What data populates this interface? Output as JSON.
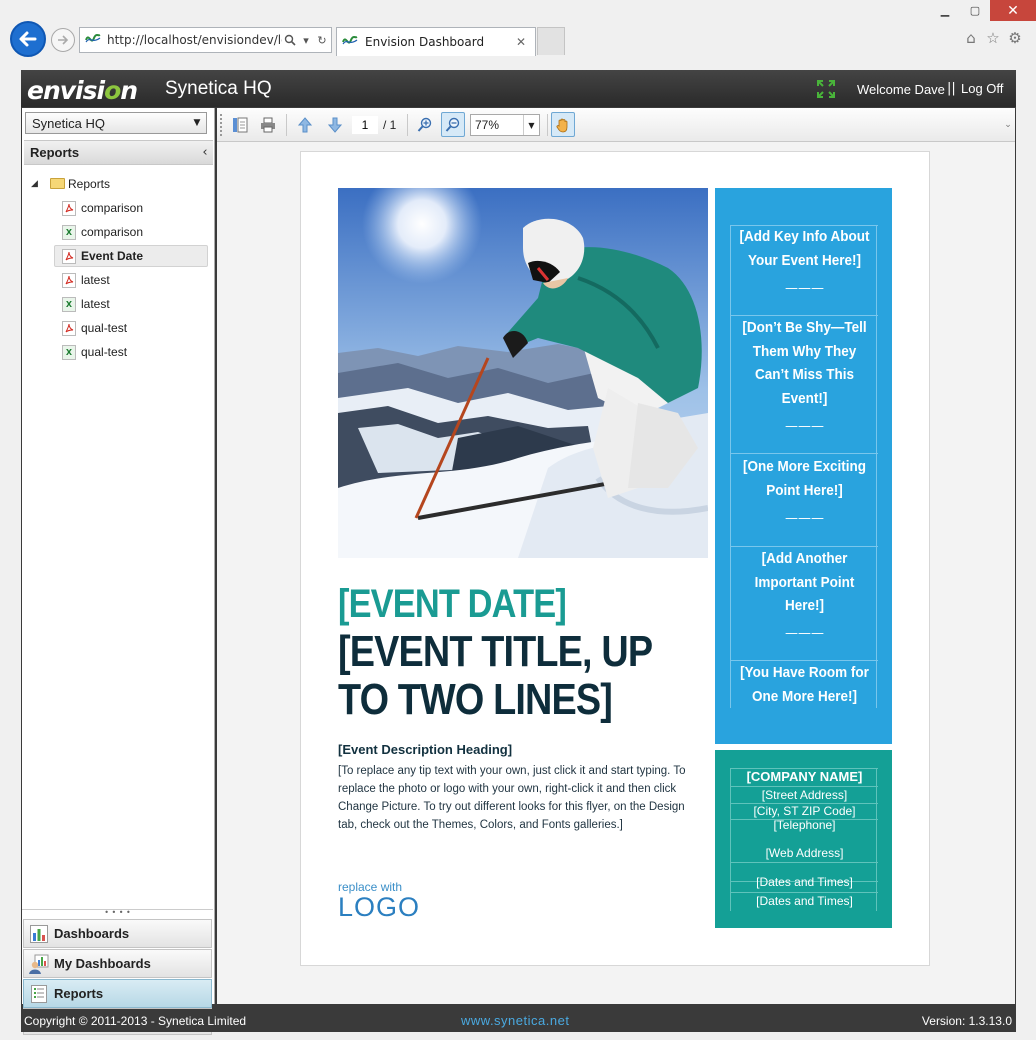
{
  "browser": {
    "url": "http://localhost/envisiondev/log",
    "tab_title": "Envision Dashboard",
    "tab_close": "✕"
  },
  "app": {
    "logo_pre": "envisi",
    "logo_o": "o",
    "logo_post": "n",
    "title": "Synetica HQ",
    "welcome": "Welcome Dave",
    "separator": "||",
    "logoff": "Log Off"
  },
  "sidebar": {
    "org_selected": "Synetica HQ",
    "section_title": "Reports",
    "collapse_glyph": "‹",
    "tree_root": "Reports",
    "items": [
      {
        "label": "comparison",
        "type": "pdf"
      },
      {
        "label": "comparison",
        "type": "xls"
      },
      {
        "label": "Event Date",
        "type": "pdf"
      },
      {
        "label": "latest",
        "type": "pdf"
      },
      {
        "label": "latest",
        "type": "xls"
      },
      {
        "label": "qual-test",
        "type": "pdf"
      },
      {
        "label": "qual-test",
        "type": "xls"
      }
    ],
    "nav": [
      {
        "label": "Dashboards"
      },
      {
        "label": "My Dashboards"
      },
      {
        "label": "Reports"
      }
    ]
  },
  "viewer": {
    "current_page": "1",
    "total_pages": "/ 1",
    "zoom": "77%"
  },
  "document": {
    "event_date": "[EVENT DATE]",
    "event_title": "[EVENT TITLE, UP TO TWO LINES]",
    "desc_heading": "[Event Description Heading]",
    "desc_body": "[To replace any tip text with your own, just click it and start typing. To replace the photo or logo with your own, right-click it and then click Change Picture. To try out different looks for this flyer, on the Design tab, check out the Themes, Colors, and Fonts galleries.]",
    "logo_small": "replace with",
    "logo_big": "LOGO",
    "info_items": [
      "[Add Key Info About Your Event Here!]",
      "[Don’t Be Shy—Tell Them Why They Can’t Miss This Event!]",
      "[One More Exciting Point Here!]",
      "[Add Another Important Point Here!]",
      "[You Have Room for One More Here!]"
    ],
    "info_dash": "———",
    "company": {
      "name": "[COMPANY NAME]",
      "street": "[Street Address]",
      "city": "[City, ST  ZIP Code]",
      "phone": "[Telephone]",
      "web": "[Web Address]",
      "dates1": "[Dates and Times]",
      "dates2": "[Dates and Times]"
    }
  },
  "footer": {
    "copyright": "Copyright © 2011-2013 - Synetica Limited",
    "site": "www.synetica.net",
    "version": "Version: 1.3.13.0"
  },
  "colors": {
    "info_blue": "#29a3de",
    "company_teal": "#14a096",
    "event_date_teal": "#1a9b93",
    "title_navy": "#0e2d3b"
  }
}
